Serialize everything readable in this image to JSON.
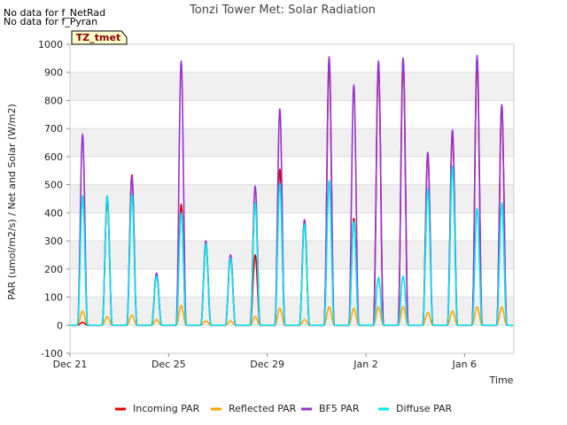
{
  "notes": [
    "No data for f_NetRad",
    "No data for f_Pyran"
  ],
  "badge": "TZ_tmet",
  "chart_data": {
    "type": "line",
    "title": "Tonzi Tower Met: Solar Radiation",
    "xlabel": "Time",
    "ylabel": "PAR (umol/m2/s) / Net and Solar (W/m2)",
    "ylim": [
      -100,
      1000
    ],
    "xlim": [
      "2023-12-21",
      "2024-01-08"
    ],
    "yticks": [
      -100,
      0,
      100,
      200,
      300,
      400,
      500,
      600,
      700,
      800,
      900,
      1000
    ],
    "xticks": [
      {
        "label": "Dec 21",
        "date": "2023-12-21"
      },
      {
        "label": "Dec 25",
        "date": "2023-12-25"
      },
      {
        "label": "Dec 29",
        "date": "2023-12-29"
      },
      {
        "label": "Jan 2",
        "date": "2024-01-02"
      },
      {
        "label": "Jan 6",
        "date": "2024-01-06"
      }
    ],
    "grid": true,
    "legend_position": "bottom",
    "series": [
      {
        "name": "Incoming PAR",
        "color": "#dd0000",
        "values": [
          10,
          450,
          535,
          185,
          430,
          290,
          250,
          250,
          555,
          375,
          940,
          380,
          930,
          950,
          610,
          690,
          950,
          780
        ]
      },
      {
        "name": "Reflected PAR",
        "color": "#ffa500",
        "values": [
          50,
          30,
          35,
          20,
          70,
          15,
          15,
          30,
          60,
          20,
          65,
          60,
          65,
          65,
          45,
          50,
          65,
          65
        ]
      },
      {
        "name": "BF5 PAR",
        "color": "#9932cc",
        "values": [
          680,
          460,
          530,
          185,
          940,
          300,
          250,
          495,
          770,
          375,
          955,
          855,
          940,
          950,
          615,
          695,
          960,
          785
        ]
      },
      {
        "name": "Diffuse PAR",
        "color": "#00e5ee",
        "values": [
          460,
          460,
          465,
          175,
          400,
          290,
          240,
          435,
          505,
          360,
          515,
          370,
          170,
          175,
          485,
          565,
          415,
          435
        ]
      }
    ],
    "day_labels": [
      "2023-12-21",
      "2023-12-22",
      "2023-12-23",
      "2023-12-24",
      "2023-12-25",
      "2023-12-26",
      "2023-12-27",
      "2023-12-28",
      "2023-12-29",
      "2023-12-30",
      "2023-12-31",
      "2024-01-01",
      "2024-01-02",
      "2024-01-03",
      "2024-01-04",
      "2024-01-05",
      "2024-01-06",
      "2024-01-07"
    ]
  }
}
